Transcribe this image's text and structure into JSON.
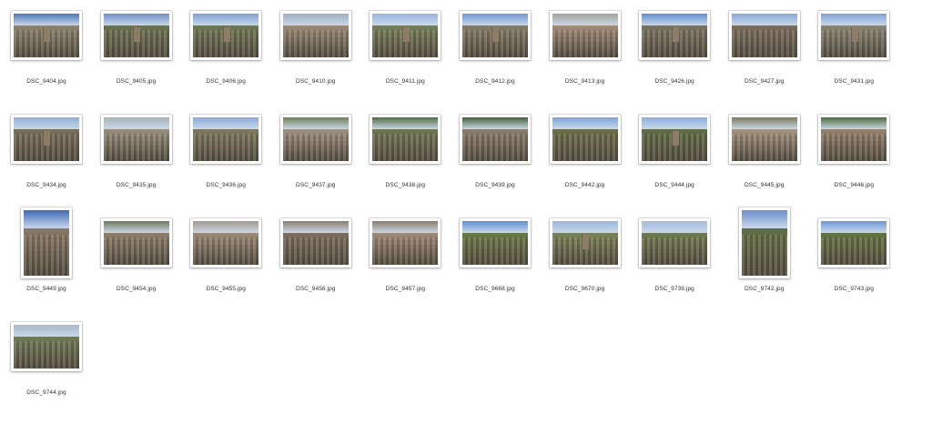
{
  "files": [
    {
      "name": "DSC_9404.jpg",
      "orientation": "landscape",
      "sky": "#4d77b8",
      "ground": "#8d856f",
      "tower": true
    },
    {
      "name": "DSC_9405.jpg",
      "orientation": "landscape",
      "sky": "#6d8fc7",
      "ground": "#6c7452",
      "tower": true
    },
    {
      "name": "DSC_9406.jpg",
      "orientation": "landscape",
      "sky": "#7ca0d2",
      "ground": "#6e7854",
      "tower": true
    },
    {
      "name": "DSC_9410.jpg",
      "orientation": "landscape",
      "sky": "#9eb0bf",
      "ground": "#9b8a75",
      "tower": false
    },
    {
      "name": "DSC_9411.jpg",
      "orientation": "landscape",
      "sky": "#9bb6dd",
      "ground": "#75805a",
      "tower": true
    },
    {
      "name": "DSC_9412.jpg",
      "orientation": "landscape",
      "sky": "#6f98d2",
      "ground": "#857e69",
      "tower": true
    },
    {
      "name": "DSC_9413.jpg",
      "orientation": "landscape",
      "sky": "#a3a39a",
      "ground": "#a38e79",
      "tower": false
    },
    {
      "name": "DSC_9426.jpg",
      "orientation": "landscape",
      "sky": "#5f8ed3",
      "ground": "#7b7464",
      "tower": true
    },
    {
      "name": "DSC_9427.jpg",
      "orientation": "landscape",
      "sky": "#86a8d6",
      "ground": "#7a6f5e",
      "tower": false
    },
    {
      "name": "DSC_9431.jpg",
      "orientation": "landscape",
      "sky": "#7fa3d4",
      "ground": "#8a8676",
      "tower": true
    },
    {
      "name": "DSC_9434.jpg",
      "orientation": "landscape",
      "sky": "#8fb0d8",
      "ground": "#786f5b",
      "tower": true
    },
    {
      "name": "DSC_9435.jpg",
      "orientation": "landscape",
      "sky": "#a8b5b9",
      "ground": "#9a8f7d",
      "tower": false
    },
    {
      "name": "DSC_9436.jpg",
      "orientation": "landscape",
      "sky": "#89a9d6",
      "ground": "#7d7a5d",
      "tower": false
    },
    {
      "name": "DSC_9437.jpg",
      "orientation": "landscape",
      "sky": "#6e7f56",
      "ground": "#a09282",
      "tower": false
    },
    {
      "name": "DSC_9438.jpg",
      "orientation": "landscape",
      "sky": "#4f6d3c",
      "ground": "#6f7752",
      "tower": false
    },
    {
      "name": "DSC_9439.jpg",
      "orientation": "landscape",
      "sky": "#44603a",
      "ground": "#8b7f6e",
      "tower": false
    },
    {
      "name": "DSC_9442.jpg",
      "orientation": "landscape",
      "sky": "#7ba3d9",
      "ground": "#6a7048",
      "tower": false
    },
    {
      "name": "DSC_9444.jpg",
      "orientation": "landscape",
      "sky": "#8aaedc",
      "ground": "#5f6d45",
      "tower": true
    },
    {
      "name": "DSC_9445.jpg",
      "orientation": "landscape",
      "sky": "#7c7a5c",
      "ground": "#a69580",
      "tower": false
    },
    {
      "name": "DSC_9446.jpg",
      "orientation": "landscape",
      "sky": "#4c6b3b",
      "ground": "#96836e",
      "tower": false
    },
    {
      "name": "DSC_9449.jpg",
      "orientation": "portrait",
      "sky": "#3e69b8",
      "ground": "#8a7a66",
      "tower": false
    },
    {
      "name": "DSC_9454.jpg",
      "orientation": "landscape",
      "sky": "#6f7a5a",
      "ground": "#8e7f6b",
      "tower": false
    },
    {
      "name": "DSC_9455.jpg",
      "orientation": "landscape",
      "sky": "#a29a8c",
      "ground": "#9c8a77",
      "tower": false
    },
    {
      "name": "DSC_9456.jpg",
      "orientation": "landscape",
      "sky": "#8c8070",
      "ground": "#7d6e5f",
      "tower": false
    },
    {
      "name": "DSC_9457.jpg",
      "orientation": "landscape",
      "sky": "#8b7d69",
      "ground": "#a08a78",
      "tower": false
    },
    {
      "name": "DSC_9668.jpg",
      "orientation": "landscape",
      "sky": "#5d90d6",
      "ground": "#6a7a43",
      "tower": false
    },
    {
      "name": "DSC_9670.jpg",
      "orientation": "landscape",
      "sky": "#9ab7de",
      "ground": "#7a8356",
      "tower": true
    },
    {
      "name": "DSC_9739.jpg",
      "orientation": "landscape",
      "sky": "#a5bddf",
      "ground": "#6f7b50",
      "tower": false
    },
    {
      "name": "DSC_9742.jpg",
      "orientation": "portrait",
      "sky": "#6b8fcf",
      "ground": "#5f7044",
      "tower": false
    },
    {
      "name": "DSC_9743.jpg",
      "orientation": "landscape",
      "sky": "#6b97d6",
      "ground": "#63743f",
      "tower": false
    },
    {
      "name": "DSC_9744.jpg",
      "orientation": "landscape",
      "sky": "#a7b9c8",
      "ground": "#6f7b56",
      "tower": false
    }
  ]
}
